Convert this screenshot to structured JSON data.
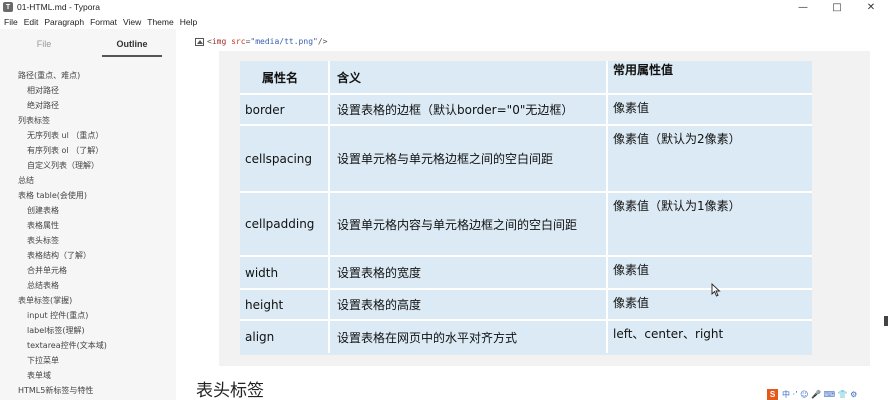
{
  "window": {
    "title": "01-HTML.md - Typora",
    "minimize": "—",
    "maximize": "□",
    "close": "✕"
  },
  "menu": [
    "File",
    "Edit",
    "Paragraph",
    "Format",
    "View",
    "Theme",
    "Help"
  ],
  "sidebar": {
    "tabs": [
      {
        "label": "File",
        "active": false
      },
      {
        "label": "Outline",
        "active": true
      }
    ],
    "outline": [
      {
        "label": "路径(重点、难点)",
        "level": 1
      },
      {
        "label": "相对路径",
        "level": 2
      },
      {
        "label": "绝对路径",
        "level": 2
      },
      {
        "label": "列表标签",
        "level": 1
      },
      {
        "label": "无序列表 ul （重点）",
        "level": 2
      },
      {
        "label": "有序列表 ol （了解）",
        "level": 2
      },
      {
        "label": "自定义列表（理解）",
        "level": 2
      },
      {
        "label": "总结",
        "level": 1
      },
      {
        "label": "表格 table(会使用)",
        "level": 1
      },
      {
        "label": "创建表格",
        "level": 2
      },
      {
        "label": "表格属性",
        "level": 2
      },
      {
        "label": "表头标签",
        "level": 2
      },
      {
        "label": "表格结构（了解）",
        "level": 2
      },
      {
        "label": "合并单元格",
        "level": 2
      },
      {
        "label": "总结表格",
        "level": 2
      },
      {
        "label": "表单标签(掌握)",
        "level": 1
      },
      {
        "label": "input 控件(重点)",
        "level": 2
      },
      {
        "label": "label标签(理解)",
        "level": 2
      },
      {
        "label": "textarea控件(文本域)",
        "level": 2
      },
      {
        "label": "下拉菜单",
        "level": 2
      },
      {
        "label": "表单域",
        "level": 2
      },
      {
        "label": "HTML5新标签与特性",
        "level": 1
      }
    ]
  },
  "editor": {
    "img_source": {
      "open": "<",
      "tag": "img",
      "attr": "src",
      "eq": "=",
      "value": "\"media/tt.png\"",
      "close": " />"
    },
    "table": {
      "headers": [
        "属性名",
        "含义",
        "常用属性值"
      ],
      "rows": [
        {
          "name": "border",
          "meaning": "设置表格的边框（默认border=\"0\"无边框）",
          "value": "像素值"
        },
        {
          "name": "cellspacing",
          "meaning": "设置单元格与单元格边框之间的空白间距",
          "value": "像素值（默认为2像素）"
        },
        {
          "name": "cellpadding",
          "meaning": "设置单元格内容与单元格边框之间的空白间距",
          "value": "像素值（默认为1像素）"
        },
        {
          "name": "width",
          "meaning": "设置表格的宽度",
          "value": "像素值"
        },
        {
          "name": "height",
          "meaning": "设置表格的高度",
          "value": "像素值"
        },
        {
          "name": "align",
          "meaning": "设置表格在网页中的水平对齐方式",
          "value": "left、center、right"
        }
      ]
    },
    "next_heading": "表头标签"
  },
  "corner_widget": {
    "badge": "S",
    "text": "中 ·’ ☺ 🎤 ⌨ 👕 ⚙"
  }
}
